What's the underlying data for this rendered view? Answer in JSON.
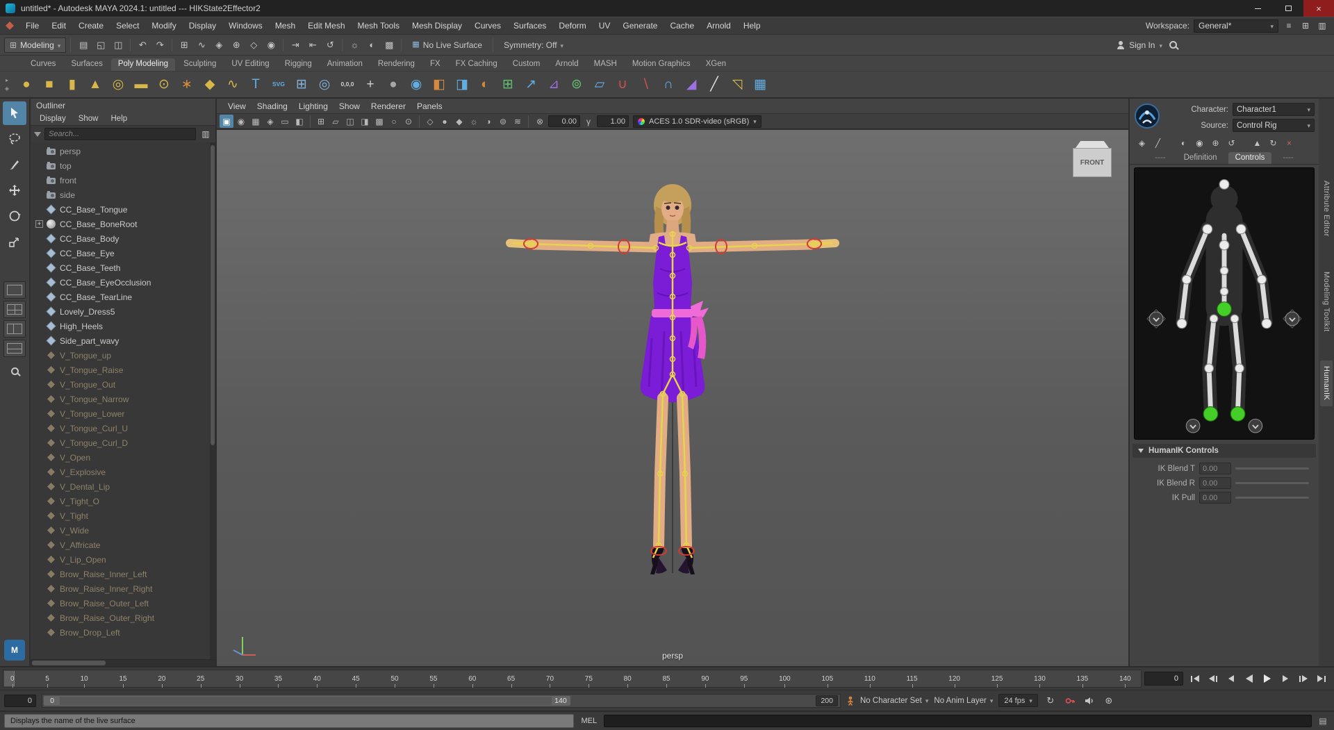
{
  "title_bar": {
    "title": "untitled* - Autodesk MAYA 2024.1: untitled   ---   HIKState2Effector2"
  },
  "menu_bar": {
    "items": [
      "File",
      "Edit",
      "Create",
      "Select",
      "Modify",
      "Display",
      "Windows",
      "Mesh",
      "Edit Mesh",
      "Mesh Tools",
      "Mesh Display",
      "Curves",
      "Surfaces",
      "Deform",
      "UV",
      "Generate",
      "Cache",
      "Arnold",
      "Help"
    ],
    "workspace_label": "Workspace:",
    "workspace_value": "General*"
  },
  "toolbar": {
    "mode": "Modeling",
    "icons": [
      {
        "name": "new-scene-icon",
        "glyph": "▤"
      },
      {
        "name": "open-scene-icon",
        "glyph": "◱"
      },
      {
        "name": "save-scene-icon",
        "glyph": "◫"
      },
      {
        "sep": true
      },
      {
        "name": "undo-icon",
        "glyph": "↶"
      },
      {
        "name": "redo-icon",
        "glyph": "↷"
      },
      {
        "sep": true
      },
      {
        "name": "snap-to-grids-icon",
        "glyph": "⊞"
      },
      {
        "name": "snap-to-curves-icon",
        "glyph": "∿"
      },
      {
        "name": "snap-to-points-icon",
        "glyph": "◈"
      },
      {
        "name": "snap-to-projected-center-icon",
        "glyph": "⊕"
      },
      {
        "name": "snap-to-view-planes-icon",
        "glyph": "◇"
      },
      {
        "name": "make-object-live-icon",
        "glyph": "◉"
      },
      {
        "sep": true
      },
      {
        "name": "input-connections-icon",
        "glyph": "⇥"
      },
      {
        "name": "output-connections-icon",
        "glyph": "⇤"
      },
      {
        "name": "construction-history-icon",
        "glyph": "↺"
      },
      {
        "sep": true
      },
      {
        "name": "render-frame-icon",
        "glyph": "☼"
      },
      {
        "name": "ipr-render-icon",
        "glyph": "◐"
      },
      {
        "name": "render-settings-icon",
        "glyph": "▩"
      },
      {
        "sep": true
      }
    ],
    "no_live_surface": "No Live Surface",
    "symmetry": "Symmetry: Off",
    "sign_in": "Sign In"
  },
  "shelf": {
    "tabs": [
      {
        "label": "Curves"
      },
      {
        "label": "Surfaces"
      },
      {
        "label": "Poly Modeling",
        "active": true
      },
      {
        "label": "Sculpting"
      },
      {
        "label": "UV Editing"
      },
      {
        "label": "Rigging"
      },
      {
        "label": "Animation"
      },
      {
        "label": "Rendering"
      },
      {
        "label": "FX"
      },
      {
        "label": "FX Caching"
      },
      {
        "label": "Custom"
      },
      {
        "label": "Arnold"
      },
      {
        "label": "MASH"
      },
      {
        "label": "Motion Graphics"
      },
      {
        "label": "XGen"
      }
    ],
    "icons": [
      {
        "name": "poly-sphere-icon",
        "glyph": "●",
        "color": "#d7b64a"
      },
      {
        "name": "poly-cube-icon",
        "glyph": "■",
        "color": "#d7b64a"
      },
      {
        "name": "poly-cylinder-icon",
        "glyph": "▮",
        "color": "#d7b64a"
      },
      {
        "name": "poly-cone-icon",
        "glyph": "▲",
        "color": "#d7b64a"
      },
      {
        "name": "poly-torus-icon",
        "glyph": "◎",
        "color": "#d7b64a"
      },
      {
        "name": "poly-plane-icon",
        "glyph": "▬",
        "color": "#d7b64a"
      },
      {
        "name": "poly-disc-icon",
        "glyph": "⊙",
        "color": "#d7b64a"
      },
      {
        "name": "poly-gear-icon",
        "glyph": "∗",
        "color": "#d78a3f"
      },
      {
        "name": "poly-super-shape-icon",
        "glyph": "◆",
        "color": "#d7b64a"
      },
      {
        "name": "sweep-mesh-icon",
        "glyph": "∿",
        "color": "#d7b64a"
      },
      {
        "name": "type-tool-icon",
        "glyph": "T",
        "color": "#62aee2"
      },
      {
        "name": "svg-tool-icon",
        "glyph": "SVG",
        "color": "#62aee2",
        "small": true
      },
      {
        "name": "construction-grid-icon",
        "glyph": "⊞",
        "color": "#7fb2d9"
      },
      {
        "name": "live-surface-select-icon",
        "glyph": "◎",
        "color": "#7fb2d9"
      },
      {
        "name": "move-to-origin-icon",
        "glyph": "0,0,0",
        "color": "#cfcfcf",
        "small": true
      },
      {
        "name": "center-pivot-icon",
        "glyph": "+",
        "color": "#cfcfcf"
      },
      {
        "name": "smooth-shade-icon",
        "glyph": "●",
        "color": "#a8a8a8"
      },
      {
        "name": "subdiv-surface-icon",
        "glyph": "◉",
        "color": "#62aee2"
      },
      {
        "name": "combine-icon",
        "glyph": "◧",
        "color": "#d78a3f"
      },
      {
        "name": "separate-icon",
        "glyph": "◨",
        "color": "#62aee2"
      },
      {
        "name": "mirror-icon",
        "glyph": "◐",
        "color": "#d78a3f"
      },
      {
        "name": "quad-draw-icon",
        "glyph": "⊞",
        "color": "#5fc06e"
      },
      {
        "name": "extract-icon",
        "glyph": "↗",
        "color": "#62aee2"
      },
      {
        "name": "extrude-icon",
        "glyph": "⊿",
        "color": "#9d6fe0"
      },
      {
        "name": "smooth-mesh-icon",
        "glyph": "⊚",
        "color": "#5fc06e"
      },
      {
        "name": "flatten-icon",
        "glyph": "▱",
        "color": "#62aee2"
      },
      {
        "name": "boolean-union-icon",
        "glyph": "∪",
        "color": "#d05050"
      },
      {
        "name": "boolean-difference-icon",
        "glyph": "∖",
        "color": "#d05050"
      },
      {
        "name": "boolean-intersect-icon",
        "glyph": "∩",
        "color": "#62aee2"
      },
      {
        "name": "wedge-icon",
        "glyph": "◢",
        "color": "#9d6fe0"
      },
      {
        "name": "multi-cut-icon",
        "glyph": "╱",
        "color": "#e0e0e0"
      },
      {
        "name": "crease-tool-icon",
        "glyph": "◹",
        "color": "#d7b64a"
      },
      {
        "name": "remesh-icon",
        "glyph": "▦",
        "color": "#62aee2"
      }
    ]
  },
  "outliner": {
    "title": "Outliner",
    "menus": [
      "Display",
      "Show",
      "Help"
    ],
    "search_placeholder": "Search...",
    "items": [
      {
        "label": "persp",
        "type": "camera"
      },
      {
        "label": "top",
        "type": "camera"
      },
      {
        "label": "front",
        "type": "camera"
      },
      {
        "label": "side",
        "type": "camera"
      },
      {
        "label": "CC_Base_Tongue",
        "type": "mesh"
      },
      {
        "label": "CC_Base_BoneRoot",
        "type": "joint",
        "expand": true
      },
      {
        "label": "CC_Base_Body",
        "type": "mesh"
      },
      {
        "label": "CC_Base_Eye",
        "type": "mesh"
      },
      {
        "label": "CC_Base_Teeth",
        "type": "mesh"
      },
      {
        "label": "CC_Base_EyeOcclusion",
        "type": "mesh"
      },
      {
        "label": "CC_Base_TearLine",
        "type": "mesh"
      },
      {
        "label": "Lovely_Dress5",
        "type": "mesh"
      },
      {
        "label": "High_Heels",
        "type": "mesh"
      },
      {
        "label": "Side_part_wavy",
        "type": "mesh"
      },
      {
        "label": "V_Tongue_up",
        "type": "blend",
        "dim": true
      },
      {
        "label": "V_Tongue_Raise",
        "type": "blend",
        "dim": true
      },
      {
        "label": "V_Tongue_Out",
        "type": "blend",
        "dim": true
      },
      {
        "label": "V_Tongue_Narrow",
        "type": "blend",
        "dim": true
      },
      {
        "label": "V_Tongue_Lower",
        "type": "blend",
        "dim": true
      },
      {
        "label": "V_Tongue_Curl_U",
        "type": "blend",
        "dim": true
      },
      {
        "label": "V_Tongue_Curl_D",
        "type": "blend",
        "dim": true
      },
      {
        "label": "V_Open",
        "type": "blend",
        "dim": true
      },
      {
        "label": "V_Explosive",
        "type": "blend",
        "dim": true
      },
      {
        "label": "V_Dental_Lip",
        "type": "blend",
        "dim": true
      },
      {
        "label": "V_Tight_O",
        "type": "blend",
        "dim": true
      },
      {
        "label": "V_Tight",
        "type": "blend",
        "dim": true
      },
      {
        "label": "V_Wide",
        "type": "blend",
        "dim": true
      },
      {
        "label": "V_Affricate",
        "type": "blend",
        "dim": true
      },
      {
        "label": "V_Lip_Open",
        "type": "blend",
        "dim": true
      },
      {
        "label": "Brow_Raise_Inner_Left",
        "type": "blend",
        "dim": true
      },
      {
        "label": "Brow_Raise_Inner_Right",
        "type": "blend",
        "dim": true
      },
      {
        "label": "Brow_Raise_Outer_Left",
        "type": "blend",
        "dim": true
      },
      {
        "label": "Brow_Raise_Outer_Right",
        "type": "blend",
        "dim": true
      },
      {
        "label": "Brow_Drop_Left",
        "type": "blend",
        "dim": true
      }
    ]
  },
  "viewport": {
    "menus": [
      "View",
      "Shading",
      "Lighting",
      "Show",
      "Renderer",
      "Panels"
    ],
    "icons": [
      {
        "name": "select-highlight-icon",
        "glyph": "▣",
        "active": true
      },
      {
        "name": "lock-camera-icon",
        "glyph": "◉"
      },
      {
        "name": "camera-attributes-icon",
        "glyph": "▦"
      },
      {
        "name": "bookmarks-icon",
        "glyph": "◈"
      },
      {
        "name": "image-plane-icon",
        "glyph": "▭"
      },
      {
        "name": "two-d-pan-zoom-icon",
        "glyph": "◧"
      },
      {
        "sep": true
      },
      {
        "name": "grid-icon",
        "glyph": "⊞"
      },
      {
        "name": "film-gate-icon",
        "glyph": "▱"
      },
      {
        "name": "resolution-gate-icon",
        "glyph": "◫"
      },
      {
        "name": "gate-mask-icon",
        "glyph": "◨"
      },
      {
        "name": "field-chart-icon",
        "glyph": "▩"
      },
      {
        "name": "safe-action-icon",
        "glyph": "○"
      },
      {
        "name": "safe-title-icon",
        "glyph": "⊙"
      },
      {
        "sep": true
      },
      {
        "name": "wireframe-icon",
        "glyph": "◇"
      },
      {
        "name": "shaded-icon",
        "glyph": "●"
      },
      {
        "name": "textured-icon",
        "glyph": "◆"
      },
      {
        "name": "lights-icon",
        "glyph": "☼"
      },
      {
        "name": "shadows-icon",
        "glyph": "◑"
      },
      {
        "name": "screen-space-ao-icon",
        "glyph": "⊚"
      },
      {
        "name": "motion-blur-icon",
        "glyph": "≋"
      },
      {
        "sep": true
      }
    ],
    "exposure": "0.00",
    "gamma": "1.00",
    "color_space": "ACES 1.0 SDR-video (sRGB)",
    "view_cube_face": "FRONT",
    "camera_label": "persp"
  },
  "character_controls": {
    "character_label": "Character:",
    "character_value": "Character1",
    "source_label": "Source:",
    "source_value": "Control Rig",
    "icons": [
      {
        "name": "skeleton-definition-icon",
        "glyph": "◈"
      },
      {
        "name": "brush-icon",
        "glyph": "╱"
      },
      {
        "name": "mirror-pose-icon",
        "glyph": "◐"
      },
      {
        "name": "lock-definition-icon",
        "glyph": "◉"
      },
      {
        "name": "pin-translate-icon",
        "glyph": "⊕"
      },
      {
        "name": "pin-rotate-icon",
        "glyph": "↺"
      },
      {
        "name": "stance-pose-icon",
        "glyph": "▲"
      },
      {
        "name": "refresh-icon",
        "glyph": "↻"
      },
      {
        "name": "delete-definition-icon",
        "glyph": "×",
        "color": "#d06060"
      }
    ],
    "tabs": [
      {
        "label": "----",
        "dim": true
      },
      {
        "label": "Definition"
      },
      {
        "label": "Controls",
        "active": true
      },
      {
        "label": "----",
        "dim": true
      }
    ],
    "section_title": "HumanIK Controls",
    "params": [
      {
        "label": "IK Blend T",
        "value": "0.00"
      },
      {
        "label": "IK Blend R",
        "value": "0.00"
      },
      {
        "label": "IK Pull",
        "value": "0.00"
      }
    ]
  },
  "side_tabs": [
    {
      "label": "Attribute Editor"
    },
    {
      "label": "Modeling Toolkit"
    },
    {
      "label": "HumanIK",
      "active": true
    }
  ],
  "time_slider": {
    "ticks": [
      "0",
      "5",
      "10",
      "15",
      "20",
      "25",
      "30",
      "35",
      "40",
      "45",
      "50",
      "55",
      "60",
      "65",
      "70",
      "75",
      "80",
      "85",
      "90",
      "95",
      "100",
      "105",
      "110",
      "115",
      "120",
      "125",
      "130",
      "135",
      "140"
    ],
    "current_frame": "0"
  },
  "range_slider": {
    "anim_start": "0",
    "playback_start": "0",
    "playback_end": "140",
    "anim_end": "200",
    "character_set": "No Character Set",
    "anim_layer": "No Anim Layer",
    "fps": "24 fps"
  },
  "command_line": {
    "label": "MEL"
  },
  "help_line": {
    "text": "Displays the name of the live surface"
  },
  "colors": {
    "accent": "#5285a6",
    "dress": "#7b1cd6",
    "skin": "#e2ad85",
    "bone_yellow": "#e8d44b",
    "effector_green": "#45cd28",
    "effector_red": "#d23b2f"
  }
}
